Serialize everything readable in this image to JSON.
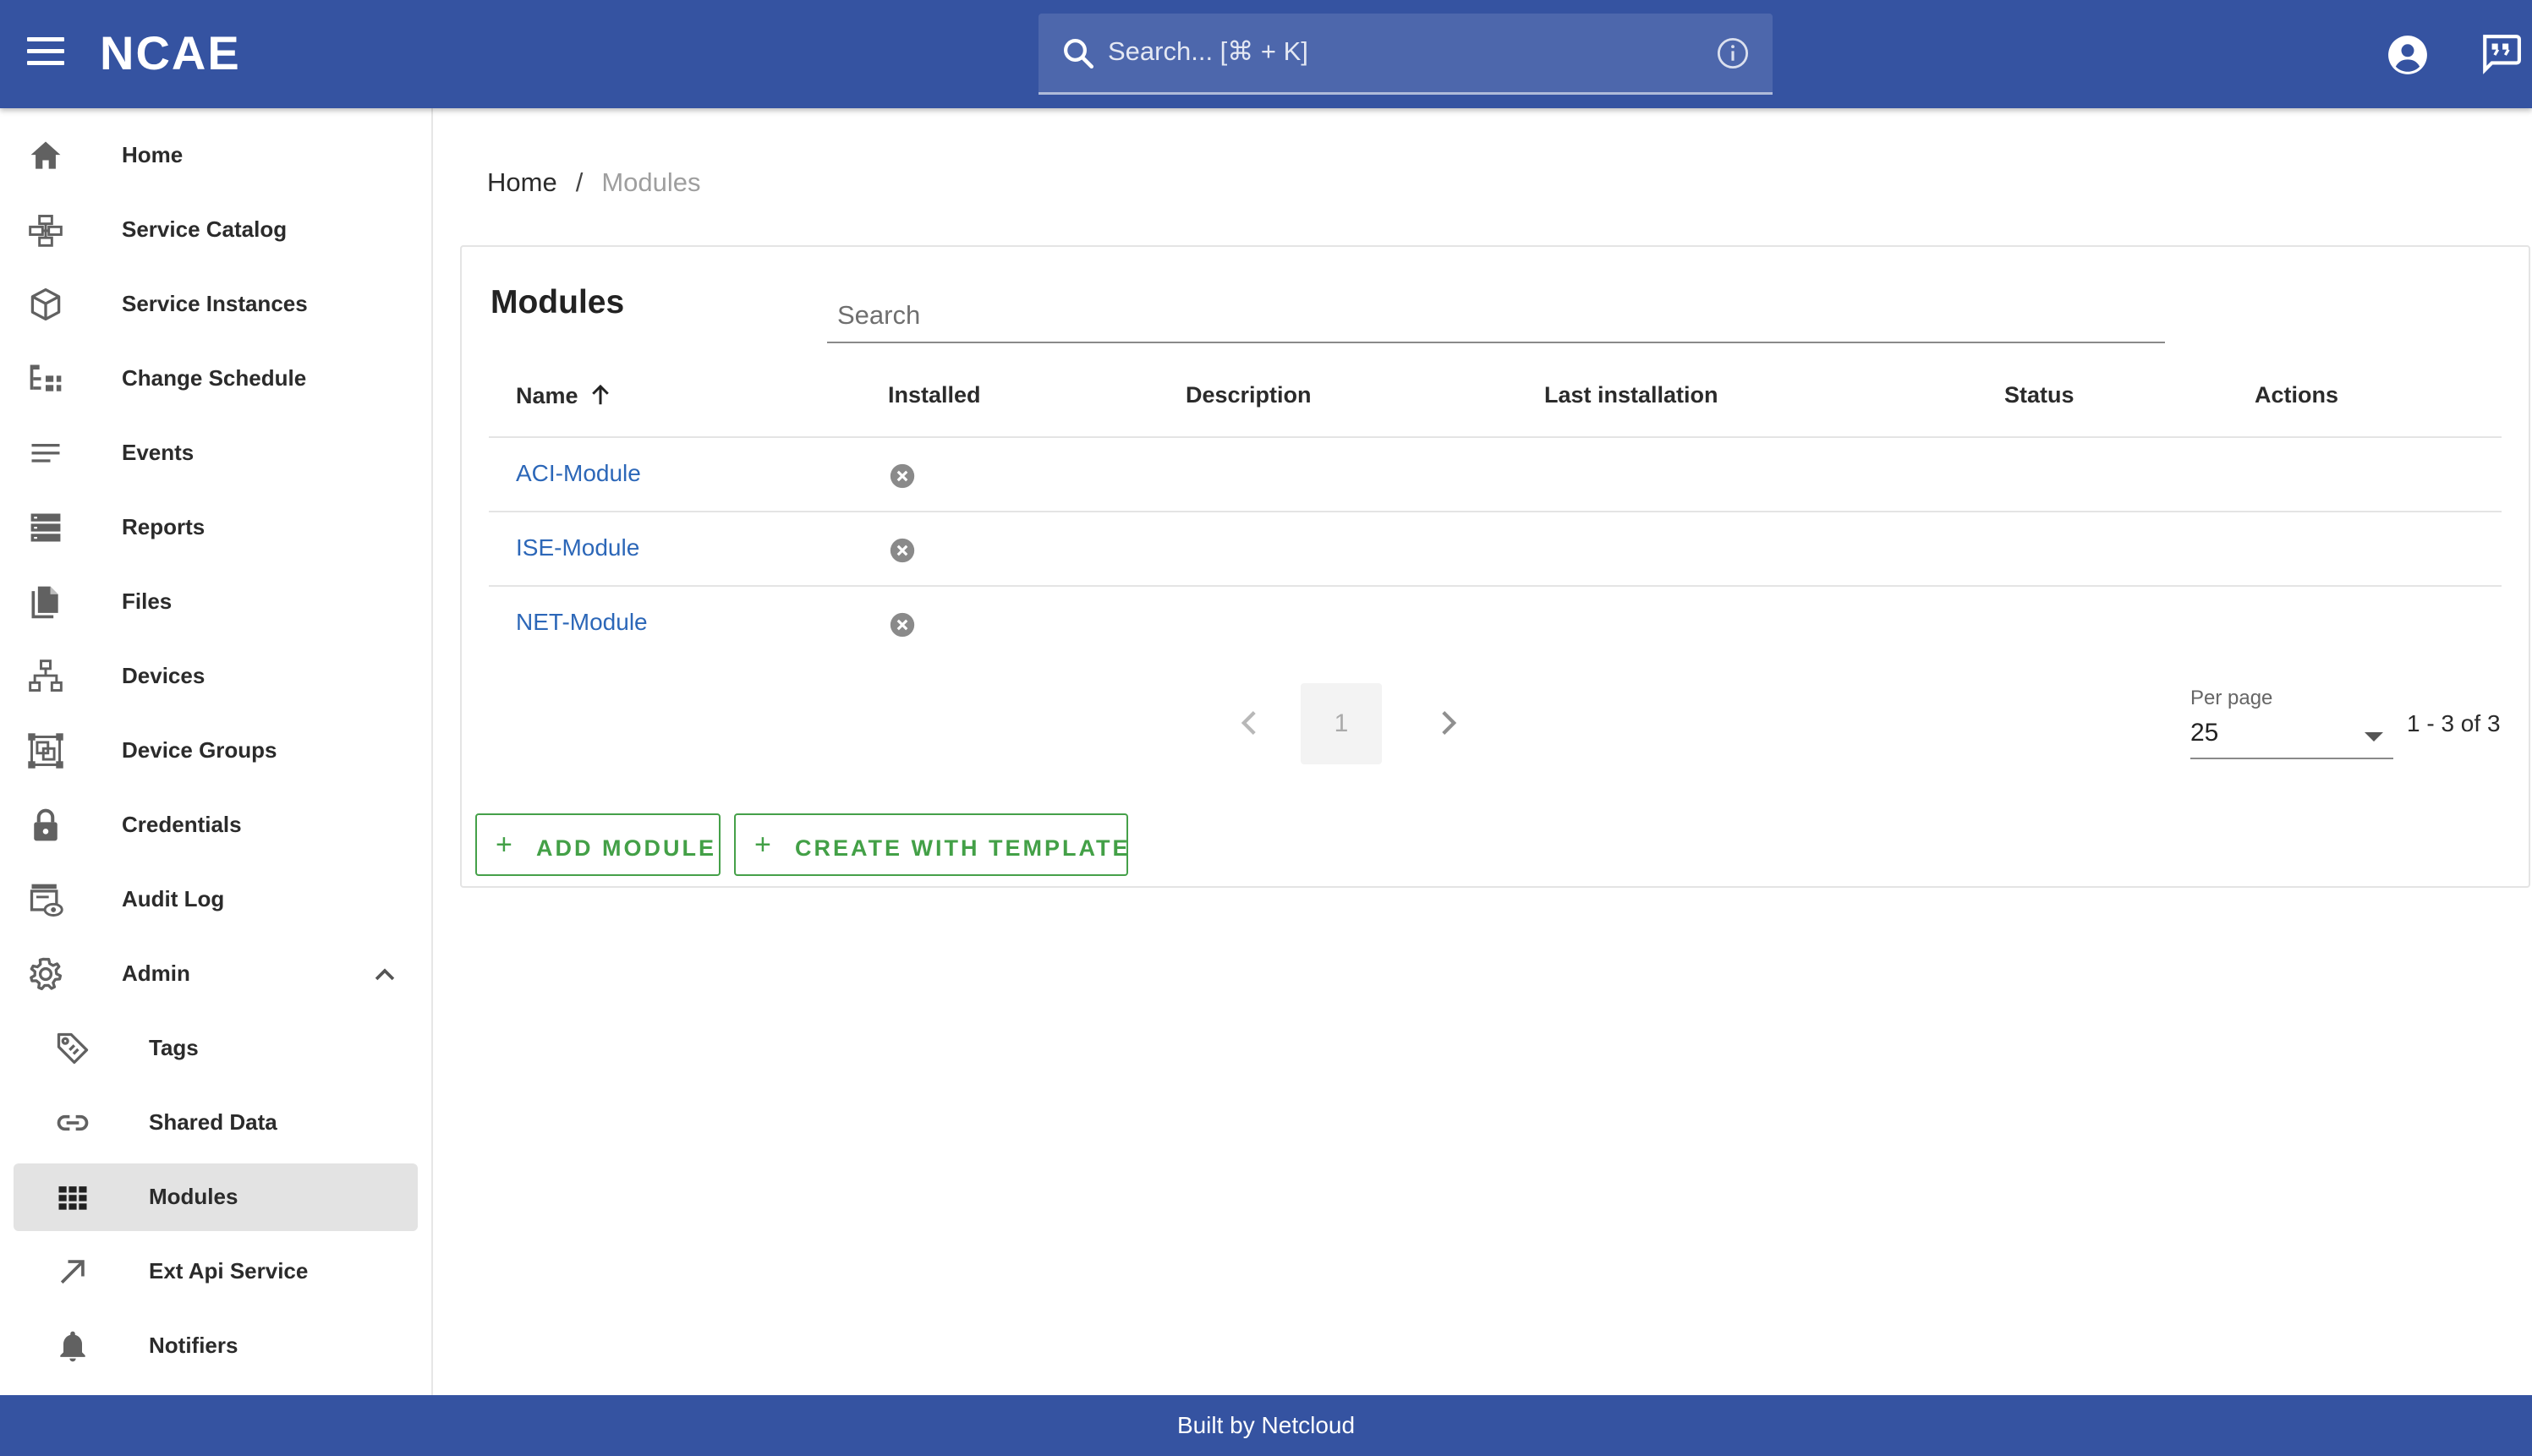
{
  "header": {
    "brand": "NCAE",
    "search_placeholder": "Search... [⌘ + K]"
  },
  "sidebar": {
    "items": [
      {
        "label": "Home",
        "icon": "home-icon"
      },
      {
        "label": "Service Catalog",
        "icon": "service-catalog-icon"
      },
      {
        "label": "Service Instances",
        "icon": "cube-icon"
      },
      {
        "label": "Change Schedule",
        "icon": "tree-list-icon"
      },
      {
        "label": "Events",
        "icon": "lines-icon"
      },
      {
        "label": "Reports",
        "icon": "storage-icon"
      },
      {
        "label": "Files",
        "icon": "files-icon"
      },
      {
        "label": "Devices",
        "icon": "network-icon"
      },
      {
        "label": "Device Groups",
        "icon": "device-groups-icon"
      },
      {
        "label": "Credentials",
        "icon": "lock-icon"
      },
      {
        "label": "Audit Log",
        "icon": "audit-log-icon"
      },
      {
        "label": "Admin",
        "icon": "gear-icon",
        "expanded": true
      }
    ],
    "admin_items": [
      {
        "label": "Tags",
        "icon": "tag-icon"
      },
      {
        "label": "Shared Data",
        "icon": "link-icon"
      },
      {
        "label": "Modules",
        "icon": "grid-icon",
        "active": true
      },
      {
        "label": "Ext Api Service",
        "icon": "arrow-up-right-icon"
      },
      {
        "label": "Notifiers",
        "icon": "bell-icon"
      }
    ]
  },
  "breadcrumb": {
    "home": "Home",
    "separator": "/",
    "current": "Modules"
  },
  "modules": {
    "title": "Modules",
    "search_placeholder": "Search",
    "columns": {
      "name": "Name",
      "installed": "Installed",
      "description": "Description",
      "last_installation": "Last installation",
      "status": "Status",
      "actions": "Actions"
    },
    "sort": {
      "column": "name",
      "direction": "ascending"
    },
    "rows": [
      {
        "name": "ACI-Module",
        "installed": false
      },
      {
        "name": "ISE-Module",
        "installed": false
      },
      {
        "name": "NET-Module",
        "installed": false
      }
    ],
    "pagination": {
      "current_page": "1",
      "per_page_label": "Per page",
      "per_page": "25",
      "range": "1 - 3 of 3"
    },
    "buttons": {
      "add": "ADD MODULE",
      "template": "CREATE WITH TEMPLATE"
    }
  },
  "footer": {
    "text": "Built by Netcloud"
  },
  "colors": {
    "header_bg": "#3553a1",
    "link": "#2c67b8",
    "button_green": "#43a047",
    "active_item_bg": "#e3e3e3"
  }
}
